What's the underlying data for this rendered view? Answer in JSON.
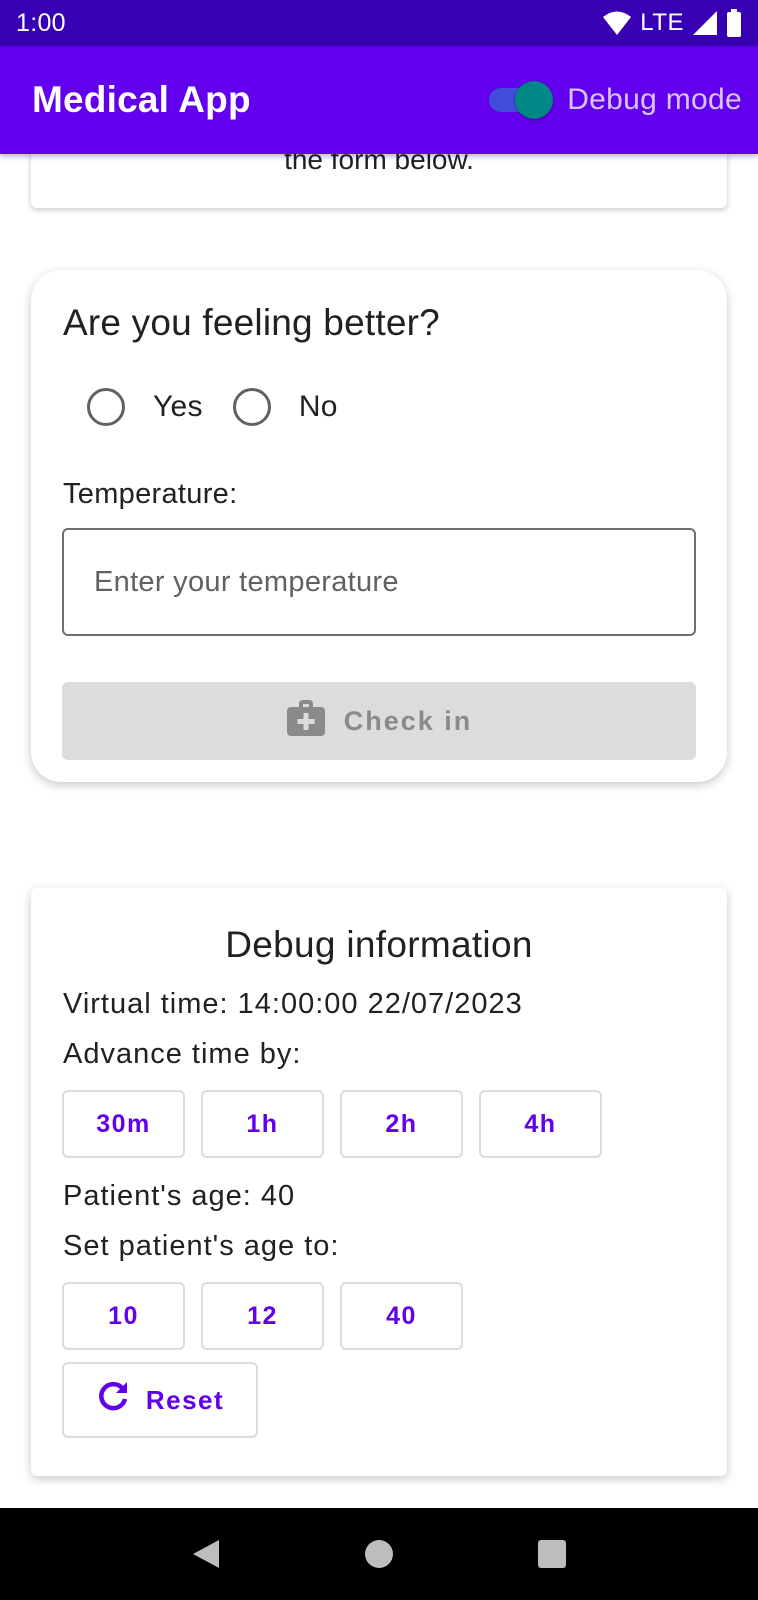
{
  "status_bar": {
    "time": "1:00",
    "network": "LTE",
    "icons": [
      "wifi-icon",
      "cell-signal-icon",
      "battery-icon"
    ]
  },
  "app_bar": {
    "title": "Medical App",
    "debug_toggle_label": "Debug mode",
    "debug_toggle_on": true
  },
  "top_card": {
    "text": "the form below."
  },
  "form": {
    "question": "Are you feeling better?",
    "options": [
      "Yes",
      "No"
    ],
    "temperature_label": "Temperature:",
    "temperature_value": "",
    "temperature_placeholder": "Enter your temperature",
    "checkin_label": "Check in",
    "checkin_icon": "medical-kit-icon",
    "checkin_enabled": false
  },
  "debug": {
    "title": "Debug information",
    "virtual_time": "Virtual time: 14:00:00 22/07/2023",
    "advance_label": "Advance time by:",
    "advance_options": [
      "30m",
      "1h",
      "2h",
      "4h"
    ],
    "patient_age": "Patient's age: 40",
    "set_age_label": "Set patient's age to:",
    "age_options": [
      "10",
      "12",
      "40"
    ],
    "reset_label": "Reset",
    "reset_icon": "refresh-icon"
  },
  "nav_bar": {
    "buttons": [
      "back-icon",
      "home-icon",
      "recents-icon"
    ]
  },
  "colors": {
    "status_bar": "#3700b3",
    "app_bar": "#6200ee",
    "accent": "#6200ee",
    "switch_thumb": "#018786",
    "disabled_button": "#dcdcdc"
  }
}
